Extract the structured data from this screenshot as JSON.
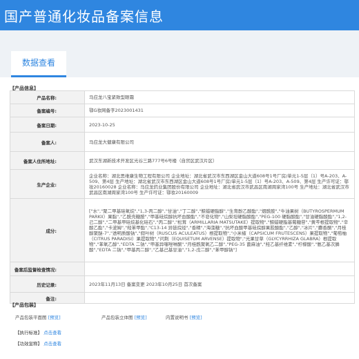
{
  "header": {
    "title": "国产普通化妆品备案信息"
  },
  "tabs": [
    {
      "label": "数据查看"
    }
  ],
  "product_section": {
    "heading": "【产品信息】"
  },
  "rows": [
    {
      "label": "产品名称:",
      "value": "马应龙八宝紧致型眼霜"
    },
    {
      "label": "备案编号:",
      "value": "鄂G妆网备字2023001431"
    },
    {
      "label": "备案日期:",
      "value": "2023-10-25"
    },
    {
      "label": "备案人:",
      "value": "马应龙大健康有限公司"
    },
    {
      "label": "备案人住所地址:",
      "value": "武汉东湖新技术开发区光谷三路777号6号楼（自贸区武汉片区）"
    },
    {
      "label": "生产企业:",
      "value": "企业名称：湖北思维康生物工程有限公司 企业地址：湖北省武汉市东西湖区金山大道608号1号厂房/单元1-5层（1）号A-203、A-509、第4层 生产地址：湖北省武汉市东西湖区金山大道608号1号厂房/单元1-5层（1）号A-203、A-509、第4层 生产许可证：鄂妆20160028 企业名称：马应龙药业集团股份有限公司 企业地址：湖北省武汉市武昌区南湖周家湾100号 生产地址：湖北省武汉市武昌区南湖周家湾100号 生产许可证：鄂妆20160009"
    },
    {
      "label": "成分:",
      "value": "[\"水\",\"聚二甲基硅氧烷\",\"1,3-丙二醇\",\"甘油\",\"丁二醇\",\"鲸蜡硬脂醇\",\"生育酚乙酸酯\",\"烟酰胺\",\"牛油果树（BUTYROSPERMUM PARKII）果脂\",\"乙酰壳糖胺\",\"甲基硅烷醇抗坏血酸酯\",\"不皂化物\",\"山梨坦硬脂酸酯\",\"PEG-100 硬脂酸酯\",\"甘油硬脂酸酯\",\"1,2-己二醇\",\"二甲基甲硅烷基化硅石\",\"丙二醇\",\"松茸（ARMILLARIA MATSUTAKE）提取物\",\"鲸蜡硬脂基葡糖苷\",\"黄芩根提取物\",\"辛酸乙酯\",\"卡波姆\",\"羟苯甲酯\",\"C13-14 异链烷烃\",\"香精\",\"海藻糖\",\"抗坏血酸甲基硅烷醇果胶酸酯\",\"乙醇\",\"冰片\",\"麝香酮\",\"月桂醇聚醚-7\",\"透明质酸钠\",\"假叶树（RUSCUS ACULEATUS）根提取物\",\"小米椒（CAPSICUM FRUTESCENS）果提取物\",\"葡萄柚（CITRUS PARADISI）果提取物\",\"问荆（EQUISETUM ARVENSE）提取物\",\"光果甘草（GLYCYRRHIZA GLABRA）根提取物\",\"苯氧乙醇\",\"EDTA 二钠\",\"甲基异噻唑啉酮\",\"月桂酰聚氧乙二醇\",\"PEG-35 蓖麻油\",\"羟乙基纤维素\",\"柠檬酸\",\"氨乙基次膦酸\",\"EDTA 二钠\",\"甲基丙二醇\",\"乙基己基甘油\",\"1,2-戊二醇\",\"苯甲醇钠\"]"
    },
    {
      "label": "备案后监督检查情况:",
      "value": ""
    },
    {
      "label": "历史记录:",
      "value": "2023年11月13日 备案变更 2023年10月25日 首次备案"
    },
    {
      "label": "备注:",
      "value": ""
    }
  ],
  "package_section": {
    "heading": "【产品包装】",
    "items": [
      {
        "label": "产品包装平面图",
        "link": "[预览]"
      },
      {
        "label": "产品包装立体图",
        "link": "[预览]"
      },
      {
        "label": "内置说明书",
        "link": "[预览]"
      }
    ]
  },
  "standard_section": {
    "heading": "【执行标准】",
    "link": "点击查看"
  },
  "efficacy_section": {
    "heading": "【功效宣称】",
    "link": "点击查看"
  }
}
